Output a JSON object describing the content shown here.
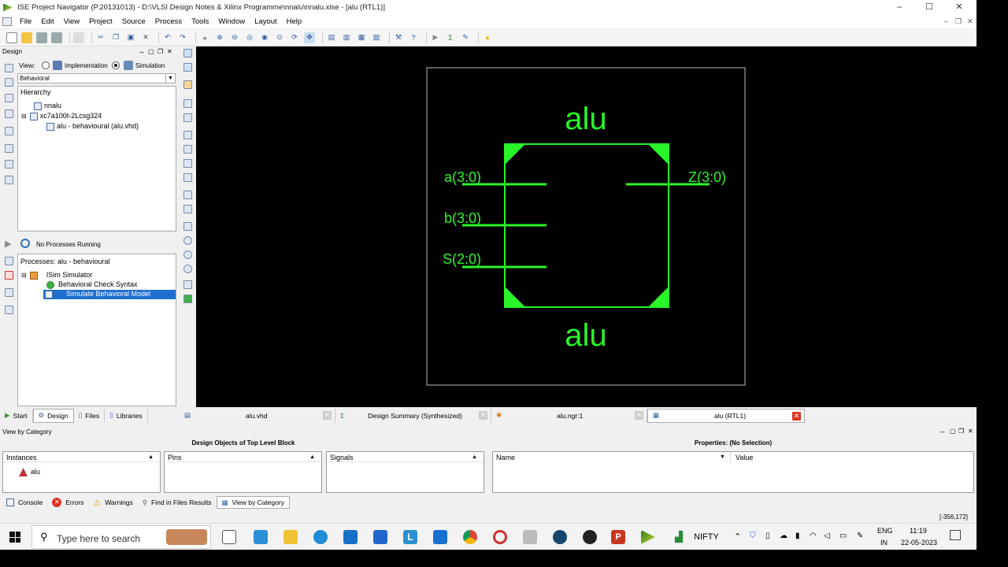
{
  "window": {
    "title": "ISE Project Navigator (P.20131013) - D:\\VLSI Design Notes & Xilinx Programme\\nnalu\\nnalu.xise - [alu (RTL1)]",
    "minimize": "–",
    "maximize": "☐",
    "close": "✕"
  },
  "menu": [
    "File",
    "Edit",
    "View",
    "Project",
    "Source",
    "Process",
    "Tools",
    "Window",
    "Layout",
    "Help"
  ],
  "design_panel": {
    "title": "Design",
    "view_label": "View:",
    "view_impl": "Implementation",
    "view_sim": "Simulation",
    "sim_dropdown": "Behavioral",
    "hierarchy_label": "Hierarchy",
    "tree": [
      "nnalu",
      "xc7a100t-2Lcsg324",
      "alu - behavioural (alu.vhd)"
    ]
  },
  "process_panel": {
    "status": "No Processes Running",
    "title": "Processes: alu - behavioural",
    "tree": [
      "ISim Simulator",
      "Behavioral Check Syntax",
      "Simulate Behavioral Model"
    ]
  },
  "schematic": {
    "top_label": "alu",
    "bottom_label": "alu",
    "inputs": [
      "a(3:0)",
      "b(3:0)",
      "S(2:0)"
    ],
    "outputs": [
      "Z(3:0)"
    ],
    "color": "#29f529"
  },
  "left_tabs": [
    "Start",
    "Design",
    "Files",
    "Libraries"
  ],
  "doc_tabs": [
    "alu.vhd",
    "Design Summary (Synthesized)",
    "alu.ngr:1",
    "alu (RTL1)"
  ],
  "bottom": {
    "title": "View by Category",
    "objects_header": "Design Objects of Top Level Block",
    "props_header": "Properties: (No Selection)",
    "instances_label": "Instances",
    "instance_item": "alu",
    "pins_label": "Pins",
    "signals_label": "Signals",
    "name_col": "Name",
    "value_col": "Value"
  },
  "status_tabs": [
    "Console",
    "Errors",
    "Warnings",
    "Find in Files Results",
    "View by Category"
  ],
  "coords": "[-356,172]",
  "taskbar": {
    "search_placeholder": "Type here to search",
    "stock": "NIFTY",
    "lang1": "ENG",
    "lang2": "IN",
    "time": "11:19",
    "date": "22-05-2023"
  }
}
